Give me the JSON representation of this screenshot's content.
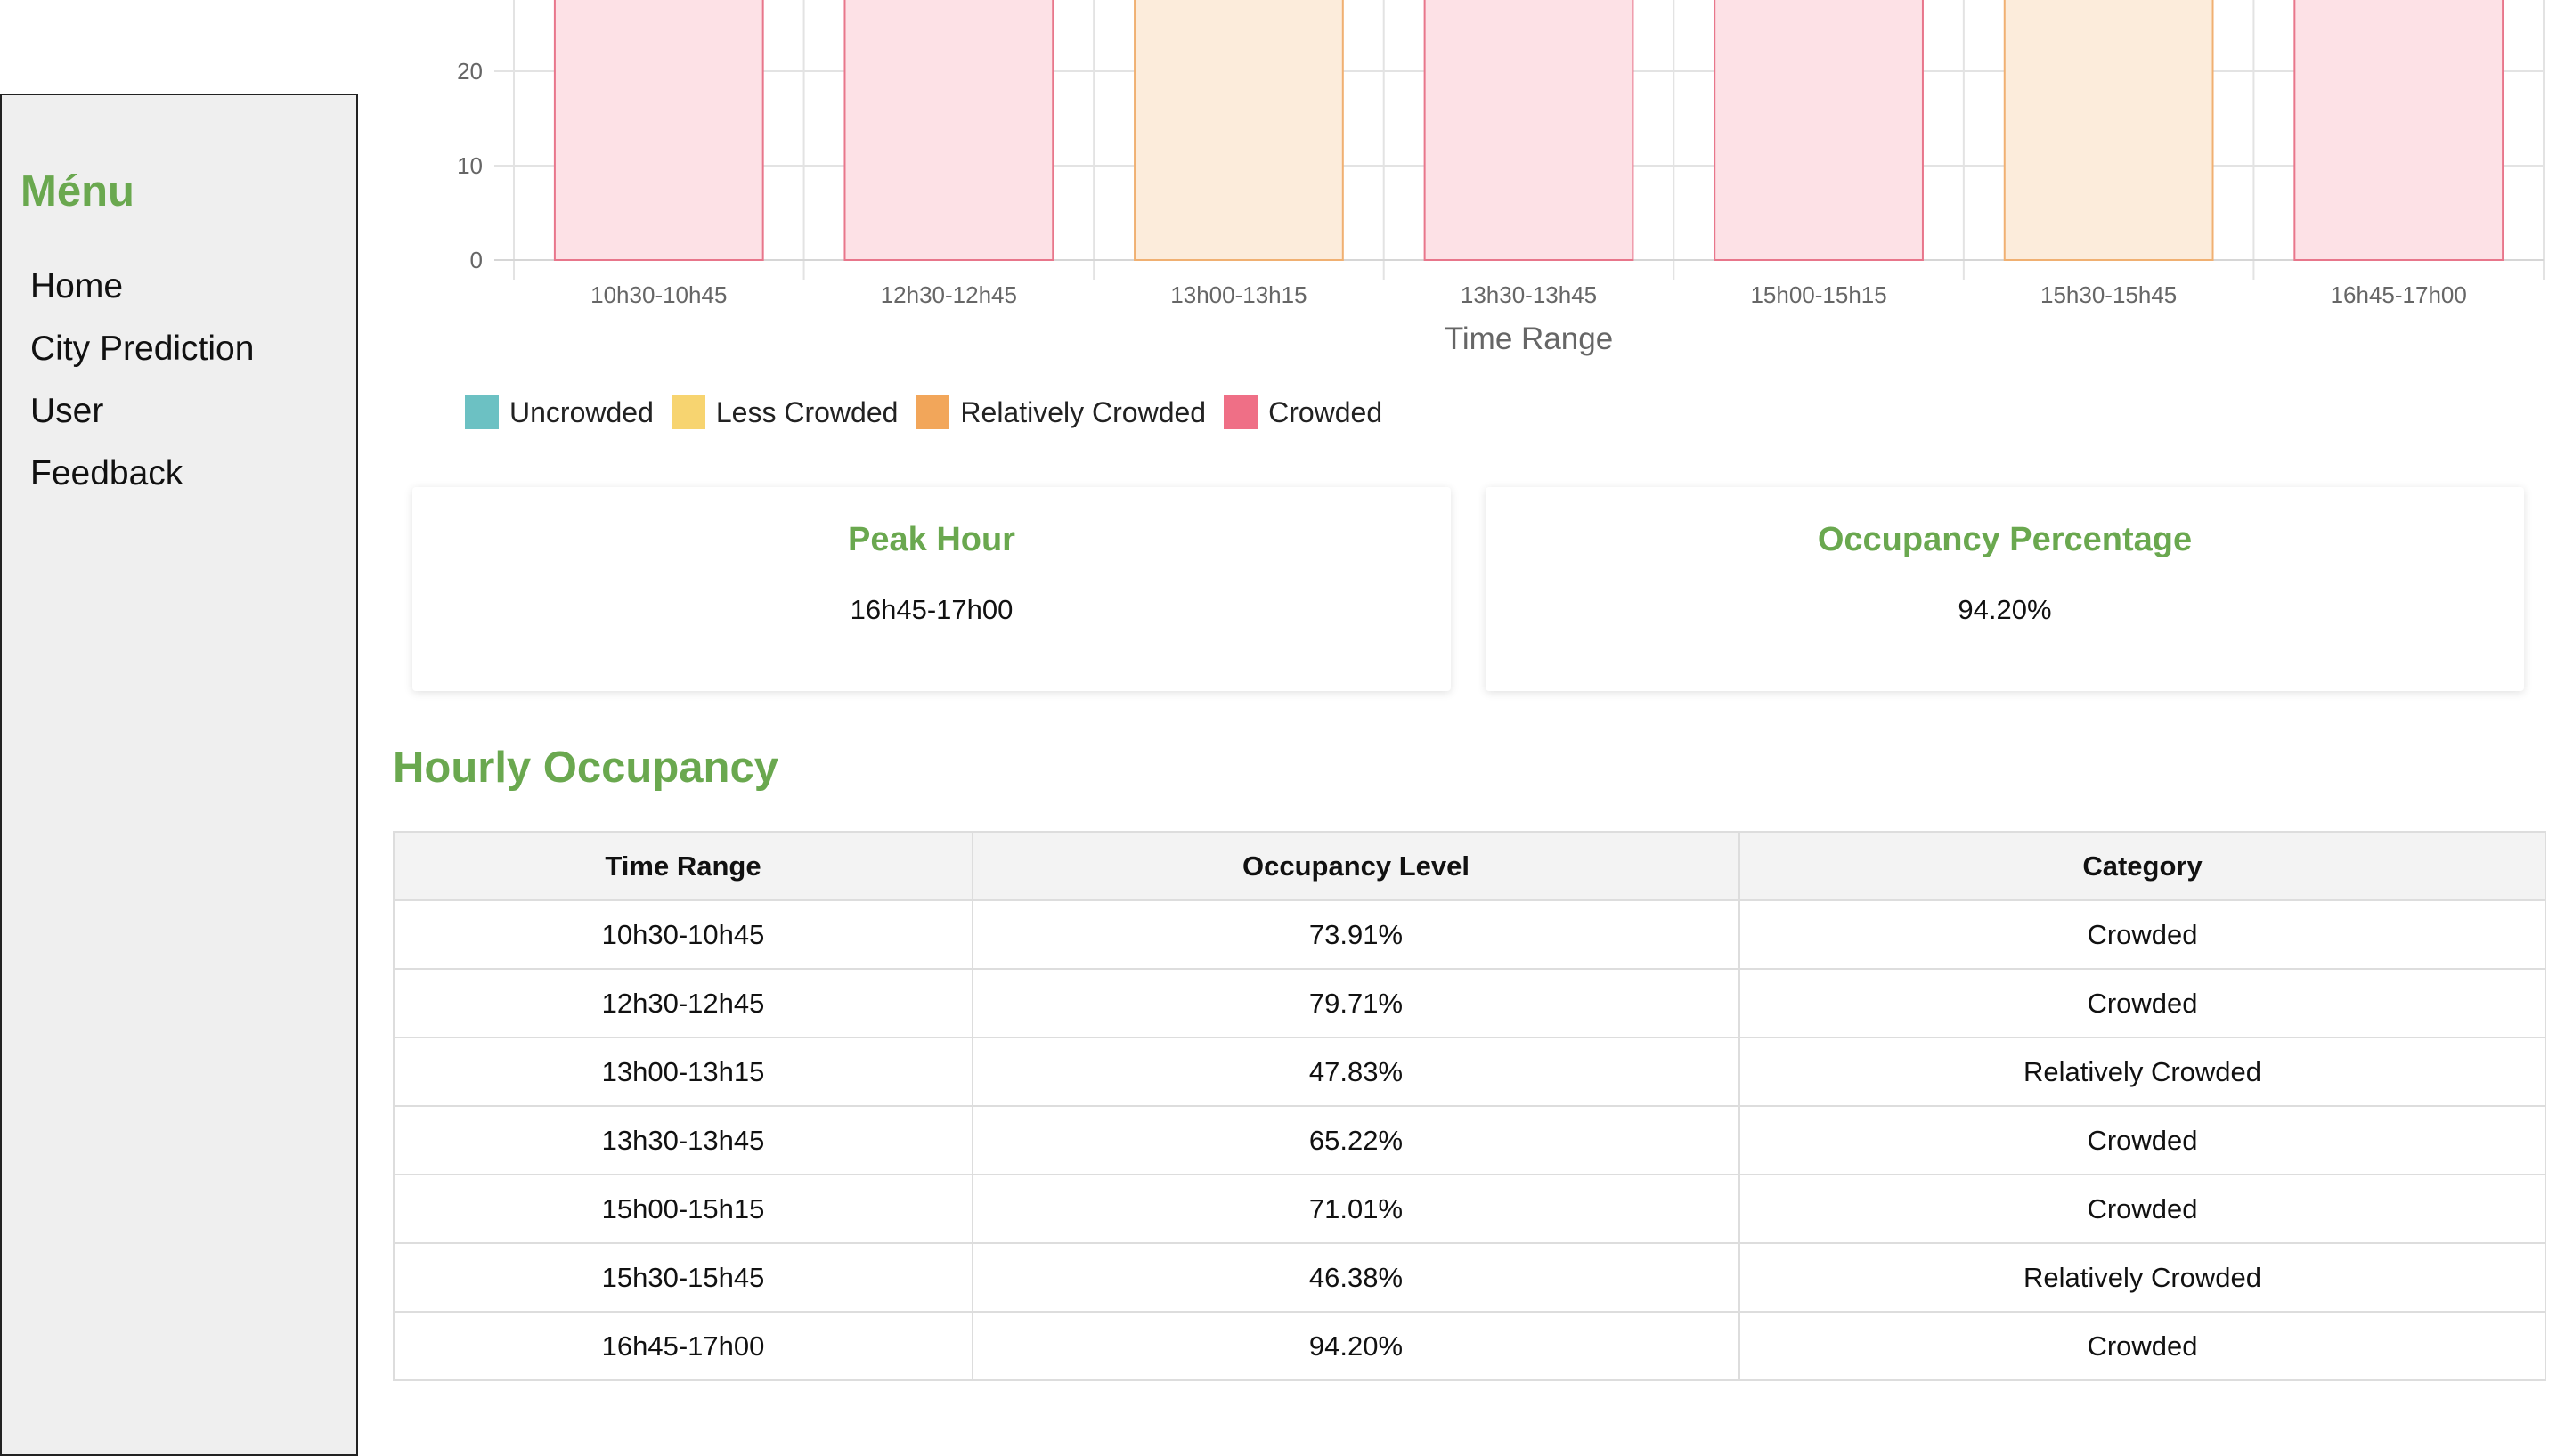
{
  "sidebar": {
    "title": "Ménu",
    "items": [
      {
        "label": "Home"
      },
      {
        "label": "City Prediction"
      },
      {
        "label": "User"
      },
      {
        "label": "Feedback"
      }
    ]
  },
  "chart_data": {
    "type": "bar",
    "xlabel": "Time Range",
    "ylabel": "",
    "ylim": [
      0,
      100
    ],
    "visible_y_ticks": [
      0,
      10,
      20
    ],
    "grid": true,
    "legend_position": "bottom-left",
    "categories": [
      "10h30-10h45",
      "12h30-12h45",
      "13h00-13h15",
      "13h30-13h45",
      "15h00-15h15",
      "15h30-15h45",
      "16h45-17h00"
    ],
    "values": [
      73.91,
      79.71,
      47.83,
      65.22,
      71.01,
      46.38,
      94.2
    ],
    "bar_categories": [
      "Crowded",
      "Crowded",
      "Relatively Crowded",
      "Crowded",
      "Crowded",
      "Relatively Crowded",
      "Crowded"
    ],
    "legend": [
      {
        "label": "Uncrowded",
        "color": "#6cc1c3",
        "fill": "#6cc1c3"
      },
      {
        "label": "Less Crowded",
        "color": "#f7d470",
        "fill": "#f7d470"
      },
      {
        "label": "Relatively Crowded",
        "color": "#f2a65a",
        "fill": "#f2a65a"
      },
      {
        "label": "Crowded",
        "color": "#ef6f86",
        "fill": "#ef6f86"
      }
    ],
    "category_styles": {
      "Crowded": {
        "fill": "#fde1e6",
        "stroke": "#e8768b"
      },
      "Relatively Crowded": {
        "fill": "#fcecdb",
        "stroke": "#f0b072"
      }
    }
  },
  "cards": {
    "peak": {
      "title": "Peak Hour",
      "value": "16h45-17h00"
    },
    "occupancy": {
      "title": "Occupancy Percentage",
      "value": "94.20%"
    }
  },
  "section": {
    "title": "Hourly Occupancy"
  },
  "table": {
    "headers": [
      "Time Range",
      "Occupancy Level",
      "Category"
    ],
    "rows": [
      [
        "10h30-10h45",
        "73.91%",
        "Crowded"
      ],
      [
        "12h30-12h45",
        "79.71%",
        "Crowded"
      ],
      [
        "13h00-13h15",
        "47.83%",
        "Relatively Crowded"
      ],
      [
        "13h30-13h45",
        "65.22%",
        "Crowded"
      ],
      [
        "15h00-15h15",
        "71.01%",
        "Crowded"
      ],
      [
        "15h30-15h45",
        "46.38%",
        "Relatively Crowded"
      ],
      [
        "16h45-17h00",
        "94.20%",
        "Crowded"
      ]
    ]
  }
}
